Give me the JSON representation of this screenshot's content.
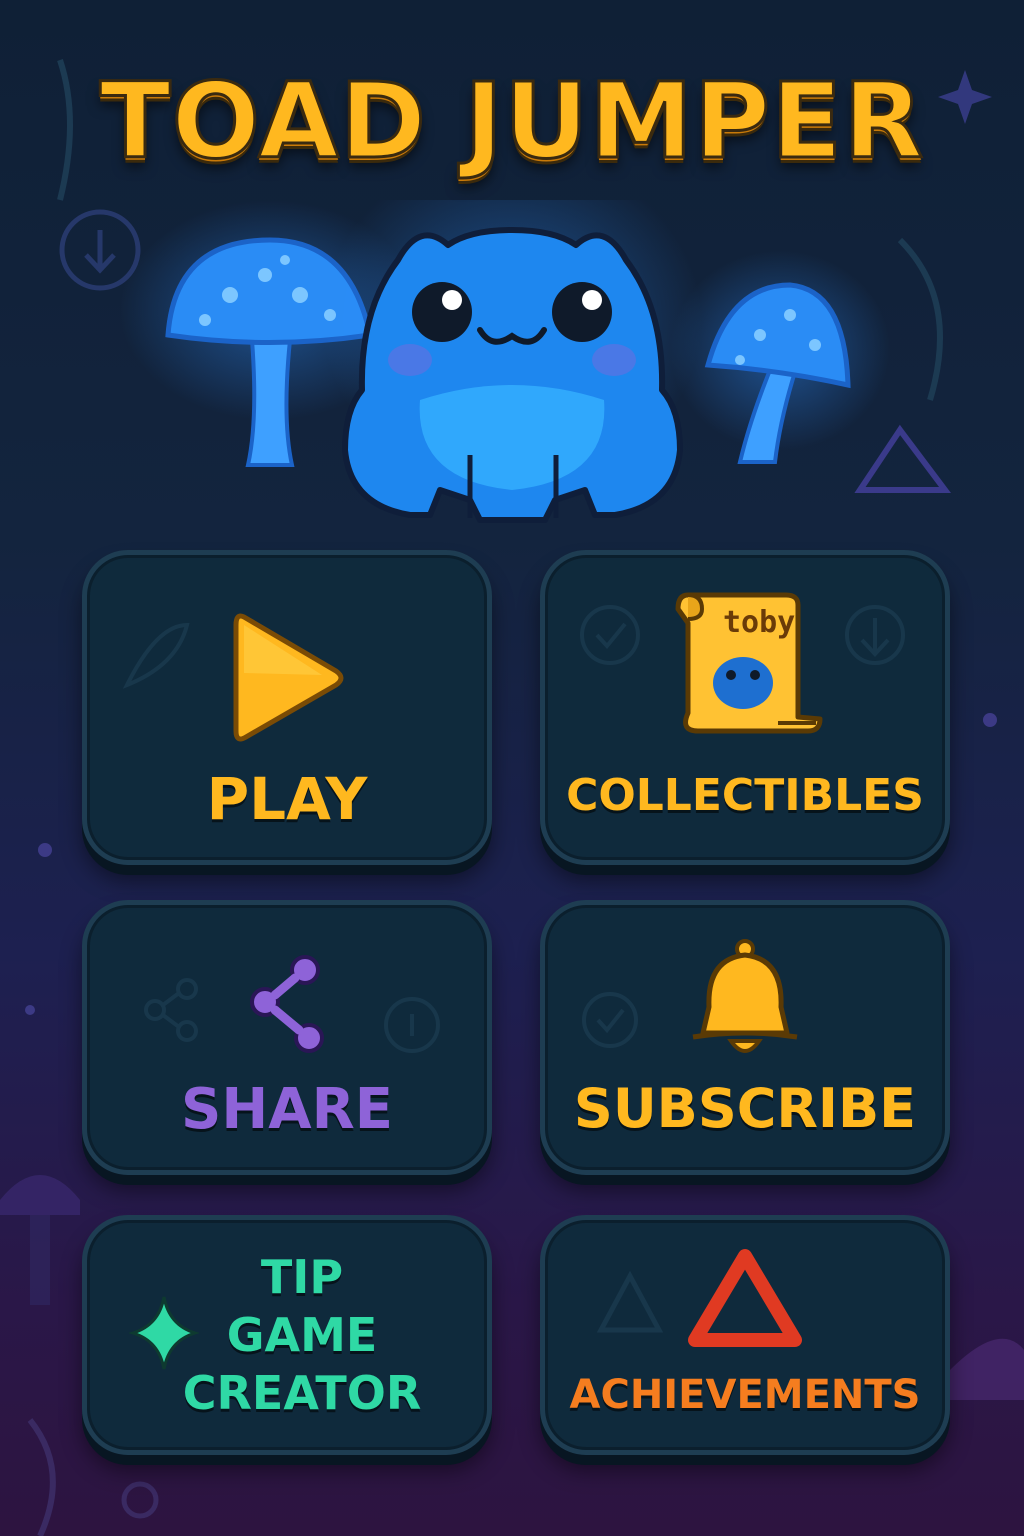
{
  "title": "TOAD JUMPER",
  "menu": {
    "play_label": "PLAY",
    "collectibles_label": "COLLECTIBLES",
    "collectible_name": "toby",
    "share_label": "SHARE",
    "subscribe_label": "SUBSCRIBE",
    "tip_label_lines": [
      "TIP",
      "GAME",
      "CREATOR"
    ],
    "achievements_label": "ACHIEVEMENTS"
  },
  "icons": {
    "play": "play-triangle-icon",
    "collectibles": "scroll-icon",
    "share": "share-icon",
    "subscribe": "bell-icon",
    "tip": "sparkle-icon",
    "achievements": "triangle-icon"
  },
  "colors": {
    "title": "#ffb81f",
    "play": "#ffb81f",
    "collectibles": "#ffb81f",
    "share": "#8e63d8",
    "subscribe": "#ffb81f",
    "tip": "#2fd9a5",
    "achievements": "#f57d1f",
    "achievements_icon": "#e03a22",
    "toad": "#1f8ff0",
    "card_bg": "#0f2a3c"
  }
}
